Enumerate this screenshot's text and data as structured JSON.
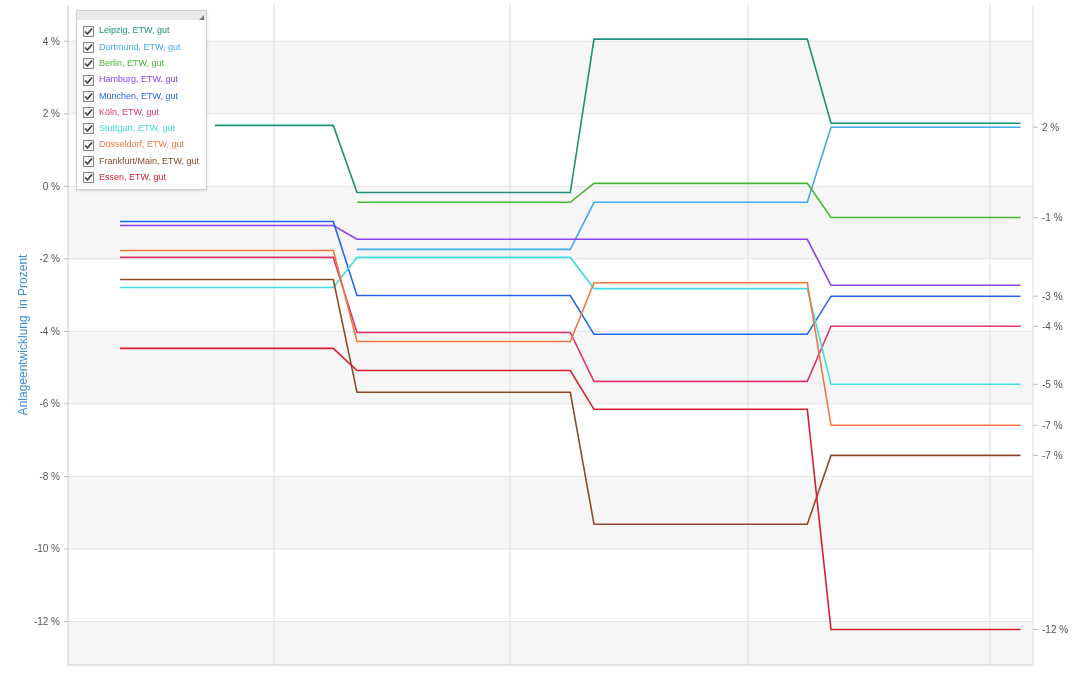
{
  "chart_data": {
    "type": "line",
    "ylabel": "Anlageentwicklung  in Prozent",
    "ylim": [
      -13.2,
      5
    ],
    "grid": true,
    "yticks": [
      {
        "value": 4,
        "label": "4 %"
      },
      {
        "value": 2,
        "label": "2 %"
      },
      {
        "value": 0,
        "label": "0 %"
      },
      {
        "value": -2,
        "label": "-2 %"
      },
      {
        "value": -4,
        "label": "-4 %"
      },
      {
        "value": -6,
        "label": "-6 %"
      },
      {
        "value": -8,
        "label": "-8 %"
      },
      {
        "value": -10,
        "label": "-10 %"
      },
      {
        "value": -12,
        "label": "-12 %"
      }
    ],
    "categories": [
      null,
      null,
      null,
      null,
      null,
      null,
      null,
      null,
      null,
      null,
      null,
      null,
      null,
      null,
      null,
      null,
      null,
      null,
      null,
      null,
      null,
      null,
      null,
      null,
      null,
      null,
      null,
      null,
      null,
      null,
      null,
      null,
      null,
      null,
      null,
      null,
      null,
      null,
      null
    ],
    "series": [
      {
        "name": "Leipzig, ETW, gut",
        "color": "#1a9078",
        "values": [
          null,
          null,
          null,
          null,
          1.68,
          1.68,
          1.68,
          1.68,
          1.68,
          1.68,
          -0.17,
          -0.17,
          -0.17,
          -0.17,
          -0.17,
          -0.17,
          -0.17,
          -0.17,
          -0.17,
          -0.17,
          4.06,
          4.06,
          4.06,
          4.06,
          4.06,
          4.06,
          4.06,
          4.06,
          4.06,
          4.06,
          1.74,
          1.74,
          1.74,
          1.74,
          1.74,
          1.74,
          1.74,
          1.74,
          1.74
        ]
      },
      {
        "name": "Dortmund, ETW, gut",
        "color": "#44aaee",
        "values": [
          null,
          null,
          null,
          null,
          null,
          null,
          null,
          null,
          null,
          null,
          -1.74,
          -1.74,
          -1.74,
          -1.74,
          -1.74,
          -1.74,
          -1.74,
          -1.74,
          -1.74,
          -1.74,
          -0.44,
          -0.44,
          -0.44,
          -0.44,
          -0.44,
          -0.44,
          -0.44,
          -0.44,
          -0.44,
          -0.44,
          1.63,
          1.63,
          1.63,
          1.63,
          1.63,
          1.63,
          1.63,
          1.63,
          1.63
        ]
      },
      {
        "name": "Berlin, ETW, gut",
        "color": "#44b833",
        "values": [
          null,
          null,
          null,
          null,
          null,
          null,
          null,
          null,
          null,
          null,
          -0.44,
          -0.44,
          -0.44,
          -0.44,
          -0.44,
          -0.44,
          -0.44,
          -0.44,
          -0.44,
          -0.44,
          0.08,
          0.08,
          0.08,
          0.08,
          0.08,
          0.08,
          0.08,
          0.08,
          0.08,
          0.08,
          -0.86,
          -0.86,
          -0.86,
          -0.86,
          -0.86,
          -0.86,
          -0.86,
          -0.86,
          -0.86
        ]
      },
      {
        "name": "Hamburg, ETW, gut",
        "color": "#8844ee",
        "values": [
          -1.08,
          -1.08,
          -1.08,
          -1.08,
          -1.08,
          -1.08,
          -1.08,
          -1.08,
          -1.08,
          -1.08,
          -1.46,
          -1.46,
          -1.46,
          -1.46,
          -1.46,
          -1.46,
          -1.46,
          -1.46,
          -1.46,
          -1.46,
          -1.46,
          -1.46,
          -1.46,
          -1.46,
          -1.46,
          -1.46,
          -1.46,
          -1.46,
          -1.46,
          -1.46,
          -2.73,
          -2.73,
          -2.73,
          -2.73,
          -2.73,
          -2.73,
          -2.73,
          -2.73,
          -2.73
        ]
      },
      {
        "name": "München, ETW, gut",
        "color": "#2266ee",
        "values": [
          -0.97,
          -0.97,
          -0.97,
          -0.97,
          -0.97,
          -0.97,
          -0.97,
          -0.97,
          -0.97,
          -0.97,
          -3.01,
          -3.01,
          -3.01,
          -3.01,
          -3.01,
          -3.01,
          -3.01,
          -3.01,
          -3.01,
          -3.01,
          -4.08,
          -4.08,
          -4.08,
          -4.08,
          -4.08,
          -4.08,
          -4.08,
          -4.08,
          -4.08,
          -4.08,
          -3.03,
          -3.03,
          -3.03,
          -3.03,
          -3.03,
          -3.03,
          -3.03,
          -3.03,
          -3.03
        ]
      },
      {
        "name": "Köln, ETW, gut",
        "color": "#e0336a",
        "values": [
          -1.96,
          -1.96,
          -1.96,
          -1.96,
          -1.96,
          -1.96,
          -1.96,
          -1.96,
          -1.96,
          -1.96,
          -4.03,
          -4.03,
          -4.03,
          -4.03,
          -4.03,
          -4.03,
          -4.03,
          -4.03,
          -4.03,
          -4.03,
          -5.38,
          -5.38,
          -5.38,
          -5.38,
          -5.38,
          -5.38,
          -5.38,
          -5.38,
          -5.38,
          -5.38,
          -3.86,
          -3.86,
          -3.86,
          -3.86,
          -3.86,
          -3.86,
          -3.86,
          -3.86,
          -3.86
        ]
      },
      {
        "name": "Stuttgart, ETW, gut",
        "color": "#44dddd",
        "values": [
          -2.79,
          -2.79,
          -2.79,
          -2.79,
          -2.79,
          -2.79,
          -2.79,
          -2.79,
          -2.79,
          -2.79,
          -1.96,
          -1.96,
          -1.96,
          -1.96,
          -1.96,
          -1.96,
          -1.96,
          -1.96,
          -1.96,
          -1.96,
          -2.82,
          -2.82,
          -2.82,
          -2.82,
          -2.82,
          -2.82,
          -2.82,
          -2.82,
          -2.82,
          -2.82,
          -5.46,
          -5.46,
          -5.46,
          -5.46,
          -5.46,
          -5.46,
          -5.46,
          -5.46,
          -5.46
        ]
      },
      {
        "name": "Düsseldorf, ETW, gut",
        "color": "#f07840",
        "values": [
          -1.77,
          -1.77,
          -1.77,
          -1.77,
          -1.77,
          -1.77,
          -1.77,
          -1.77,
          -1.77,
          -1.77,
          -4.28,
          -4.28,
          -4.28,
          -4.28,
          -4.28,
          -4.28,
          -4.28,
          -4.28,
          -4.28,
          -4.28,
          -2.66,
          -2.66,
          -2.66,
          -2.66,
          -2.66,
          -2.66,
          -2.66,
          -2.66,
          -2.66,
          -2.66,
          -6.59,
          -6.59,
          -6.59,
          -6.59,
          -6.59,
          -6.59,
          -6.59,
          -6.59,
          -6.59
        ]
      },
      {
        "name": "Frankfurt/Main, ETW, gut",
        "color": "#8b4a2a",
        "values": [
          -2.57,
          -2.57,
          -2.57,
          -2.57,
          -2.57,
          -2.57,
          -2.57,
          -2.57,
          -2.57,
          -2.57,
          -5.68,
          -5.68,
          -5.68,
          -5.68,
          -5.68,
          -5.68,
          -5.68,
          -5.68,
          -5.68,
          -5.68,
          -9.32,
          -9.32,
          -9.32,
          -9.32,
          -9.32,
          -9.32,
          -9.32,
          -9.32,
          -9.32,
          -9.32,
          -7.42,
          -7.42,
          -7.42,
          -7.42,
          -7.42,
          -7.42,
          -7.42,
          -7.42,
          -7.42
        ]
      },
      {
        "name": "Essen, ETW, gut",
        "color": "#d42030",
        "values": [
          -4.47,
          -4.47,
          -4.47,
          -4.47,
          -4.47,
          -4.47,
          -4.47,
          -4.47,
          -4.47,
          -4.47,
          -5.08,
          -5.08,
          -5.08,
          -5.08,
          -5.08,
          -5.08,
          -5.08,
          -5.08,
          -5.08,
          -5.08,
          -6.15,
          -6.15,
          -6.15,
          -6.15,
          -6.15,
          -6.15,
          -6.15,
          -6.15,
          -6.15,
          -6.15,
          -12.22,
          -12.22,
          -12.22,
          -12.22,
          -12.22,
          -12.22,
          -12.22,
          -12.22,
          -12.22
        ]
      }
    ],
    "annotations": [
      "2 %",
      "-1 %",
      "-3 %",
      "-4 %",
      "-5 %",
      "-7 %",
      "-7 %",
      "-12 %"
    ]
  },
  "legend": {
    "items": [
      {
        "checked": true
      },
      {
        "checked": true
      },
      {
        "checked": true
      },
      {
        "checked": true
      },
      {
        "checked": true
      },
      {
        "checked": true
      },
      {
        "checked": true
      },
      {
        "checked": true
      },
      {
        "checked": true
      },
      {
        "checked": true
      }
    ]
  }
}
